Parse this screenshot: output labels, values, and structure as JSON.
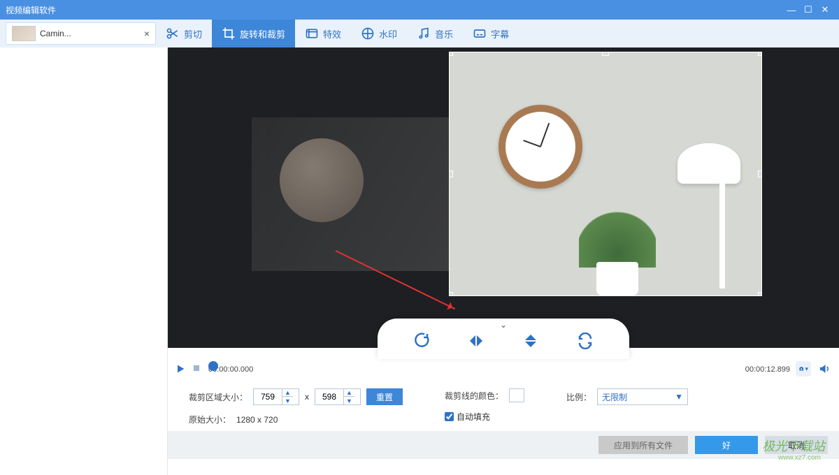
{
  "window": {
    "title": "视频编辑软件"
  },
  "file_tab": {
    "name": "Camin...",
    "close": "×"
  },
  "toolbar": {
    "cut": "剪切",
    "rotate_crop": "旋转和裁剪",
    "effects": "特效",
    "watermark": "水印",
    "music": "音乐",
    "subtitle": "字幕"
  },
  "timeline": {
    "start": "00:00:00.000",
    "end": "00:00:12.899"
  },
  "crop": {
    "size_label": "裁剪区域大小：",
    "w": "759",
    "x": "x",
    "h": "598",
    "reset": "重置",
    "orig_label": "原始大小：",
    "orig_value": "1280 x 720",
    "line_color_label": "裁剪线的颜色：",
    "autofill_label": "自动填充",
    "ratio_label": "比例：",
    "ratio_value": "无限制"
  },
  "footer": {
    "apply_all": "应用到所有文件",
    "ok": "好",
    "cancel": "取消"
  },
  "watermark": {
    "brand": "极光下载站",
    "url": "www.xz7.com"
  }
}
